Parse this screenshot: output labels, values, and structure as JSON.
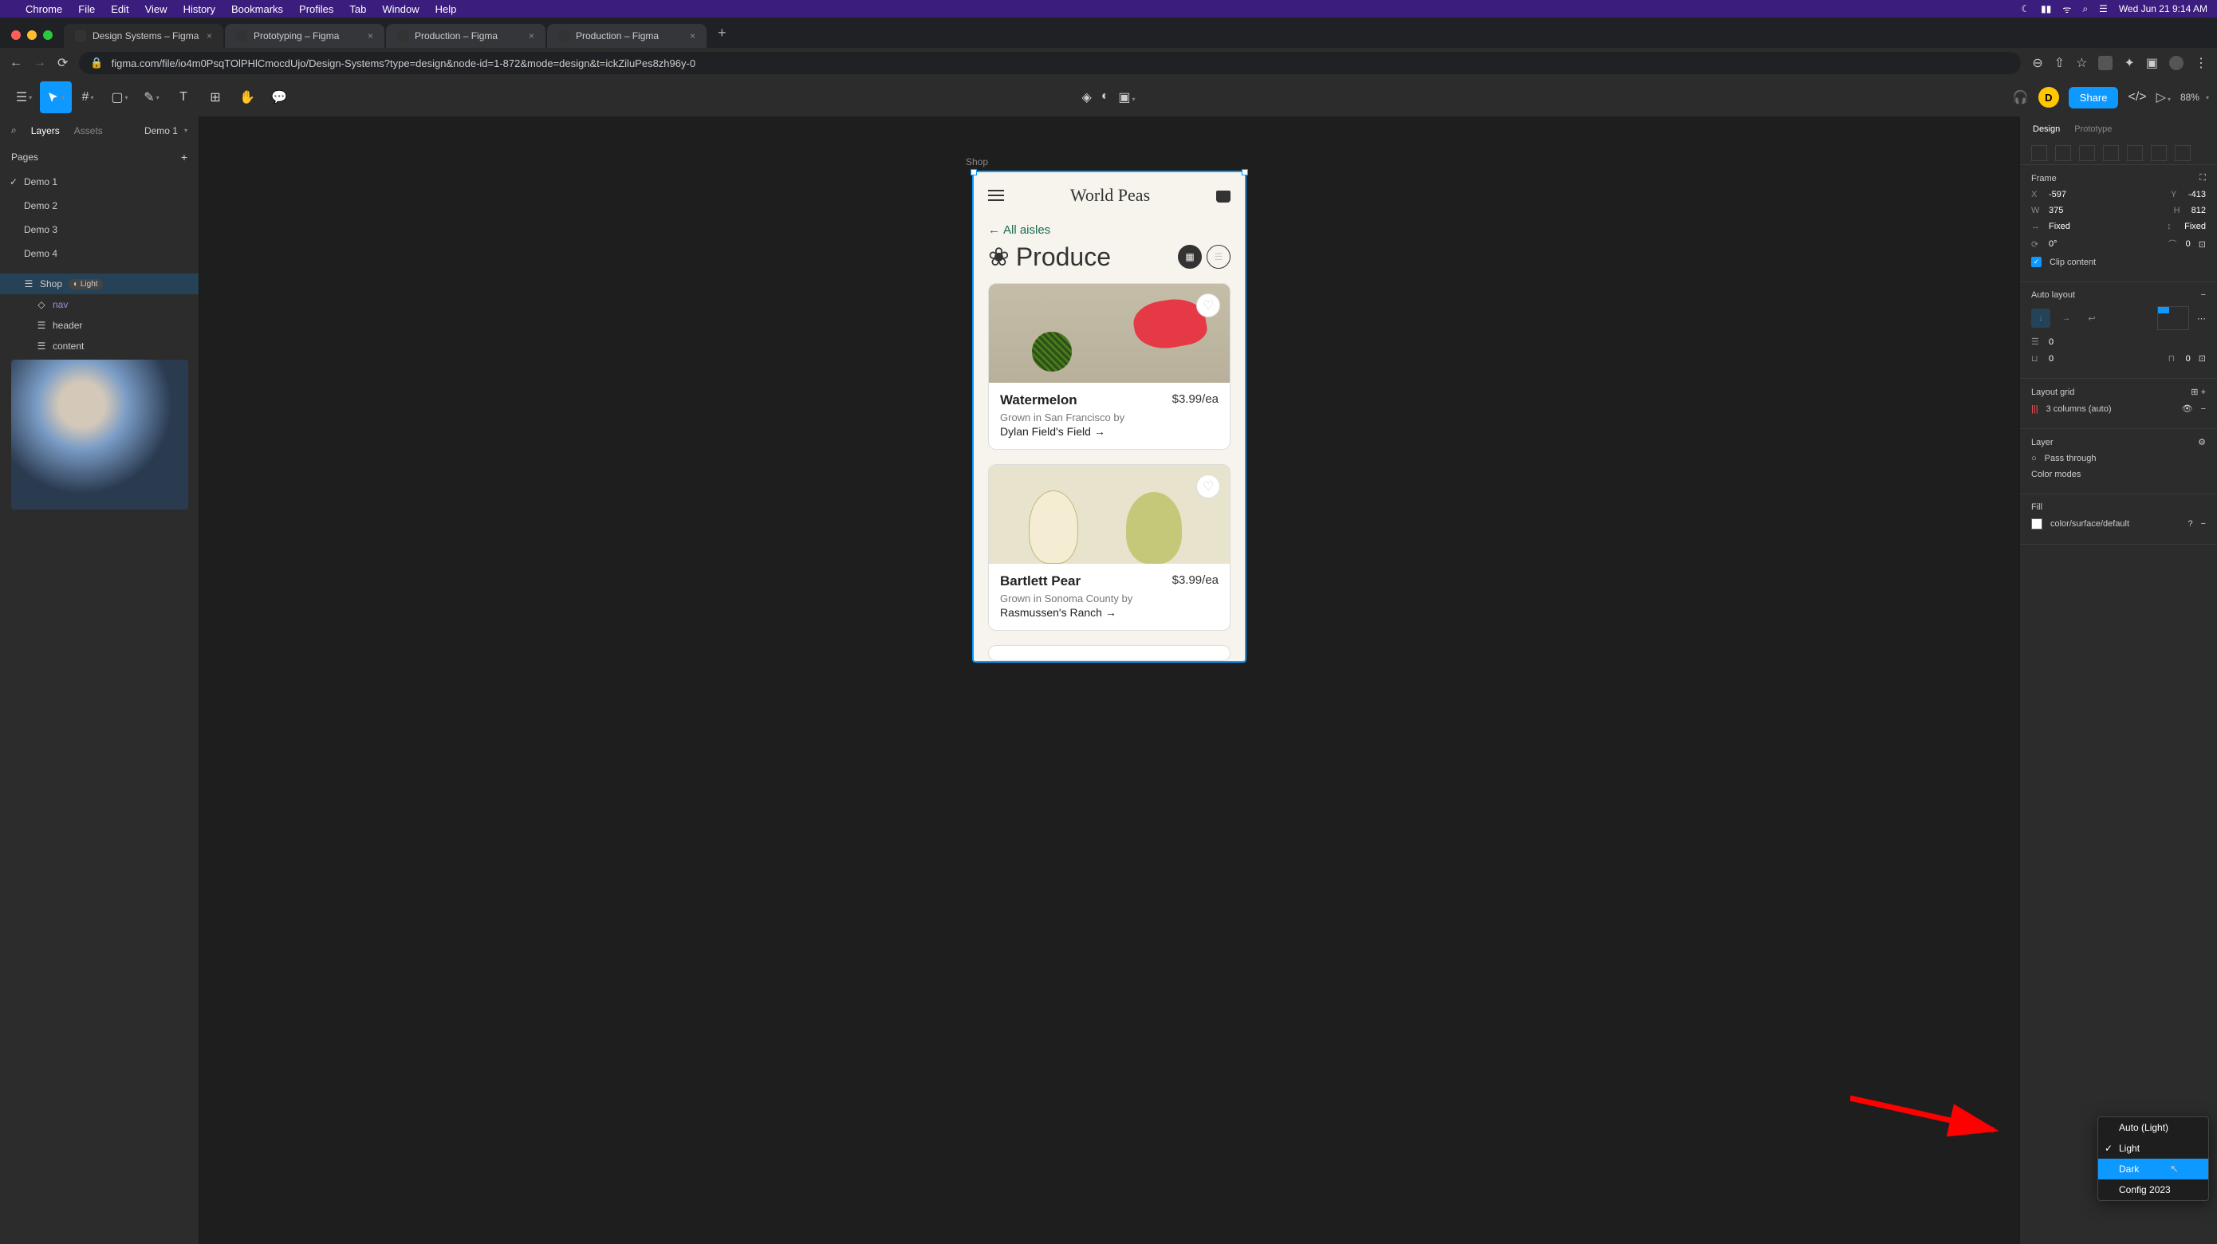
{
  "menubar": {
    "app": "Chrome",
    "items": [
      "File",
      "Edit",
      "View",
      "History",
      "Bookmarks",
      "Profiles",
      "Tab",
      "Window",
      "Help"
    ],
    "datetime": "Wed Jun 21 9:14 AM"
  },
  "tabs": [
    {
      "title": "Design Systems – Figma",
      "active": true
    },
    {
      "title": "Prototyping – Figma",
      "active": false
    },
    {
      "title": "Production – Figma",
      "active": false
    },
    {
      "title": "Production – Figma",
      "active": false
    }
  ],
  "url": "figma.com/file/io4m0PsqTOlPHlCmocdUjo/Design-Systems?type=design&node-id=1-872&mode=design&t=ickZiluPes8zh96y-0",
  "figma": {
    "zoom": "88%",
    "avatar_letter": "D",
    "share": "Share"
  },
  "left": {
    "tab_layers": "Layers",
    "tab_assets": "Assets",
    "page_current": "Demo 1",
    "pages_label": "Pages",
    "pages": [
      "Demo 1",
      "Demo 2",
      "Demo 3",
      "Demo 4"
    ],
    "layers": {
      "shop": "Shop",
      "shop_badge": "Light",
      "nav": "nav",
      "header": "header",
      "content": "content"
    }
  },
  "canvas": {
    "frame_label": "Shop",
    "app_title": "World Peas",
    "back": "All aisles",
    "section": "Produce",
    "cards": [
      {
        "name": "Watermelon",
        "price": "$3.99/ea",
        "grown": "Grown in San Francisco by",
        "farm": "Dylan Field's Field →"
      },
      {
        "name": "Bartlett Pear",
        "price": "$3.99/ea",
        "grown": "Grown in Sonoma County by",
        "farm": "Rasmussen's Ranch →"
      }
    ]
  },
  "right": {
    "tab_design": "Design",
    "tab_prototype": "Prototype",
    "frame": "Frame",
    "x": "-597",
    "y": "-413",
    "w": "375",
    "h": "812",
    "fixed1": "Fixed",
    "fixed2": "Fixed",
    "rotation": "0°",
    "radius": "0",
    "clip": "Clip content",
    "autolayout": "Auto layout",
    "spacing1": "0",
    "spacing2": "0",
    "spacing3": "0",
    "layoutgrid": "Layout grid",
    "grid_value": "3 columns (auto)",
    "layer": "Layer",
    "blend": "Pass through",
    "colormodes": "Color modes",
    "fill": "Fill",
    "fill_value": "color/surface/default",
    "dropdown": {
      "auto": "Auto (Light)",
      "light": "Light",
      "dark": "Dark",
      "config": "Config 2023"
    }
  }
}
